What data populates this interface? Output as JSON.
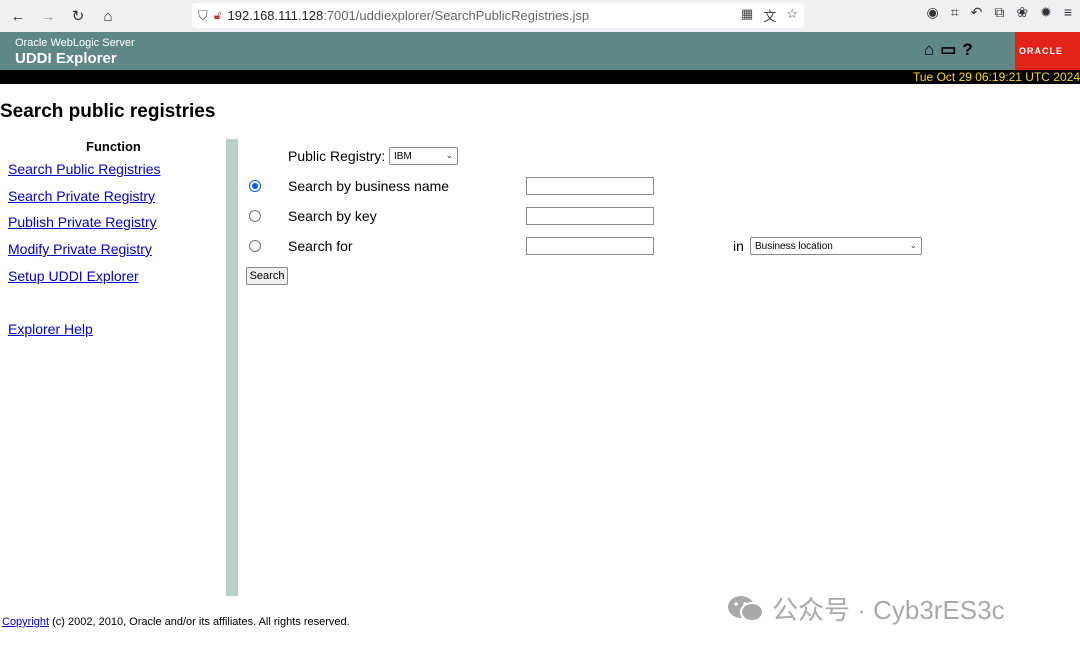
{
  "browser": {
    "url_host": "192.168.111.128",
    "url_path": ":7001/uddiexplorer/SearchPublicRegistries.jsp"
  },
  "header": {
    "subtitle": "Oracle WebLogic Server",
    "title": "UDDI Explorer",
    "datetime": "Tue Oct 29 06:19:21 UTC 2024",
    "oracle_logo": "ORACLE"
  },
  "page_title": "Search public registries",
  "sidebar": {
    "heading": "Function",
    "links": [
      "Search Public Registries",
      "Search Private Registry",
      "Publish Private Registry",
      "Modify Private Registry",
      "Setup UDDI Explorer",
      "Explorer Help"
    ]
  },
  "form": {
    "registry_label": "Public Registry:",
    "registry_value": "IBM",
    "search_by_name_label": "Search by business name",
    "search_by_key_label": "Search by key",
    "search_for_label": "Search for",
    "in_label": "in",
    "in_select_value": "Business location",
    "search_button": "Search",
    "selected_option": "business_name"
  },
  "footer": {
    "copyright_link": "Copyright",
    "text": " (c) 2002, 2010, Oracle and/or its affiliates. All rights reserved."
  },
  "watermark": "公众号 · Cyb3rES3c",
  "colors": {
    "header_bg": "#5f8785",
    "date_text": "#ffd700",
    "oracle_red": "#e2231a",
    "link": "#0000cc",
    "divider": "#b9cfca"
  }
}
